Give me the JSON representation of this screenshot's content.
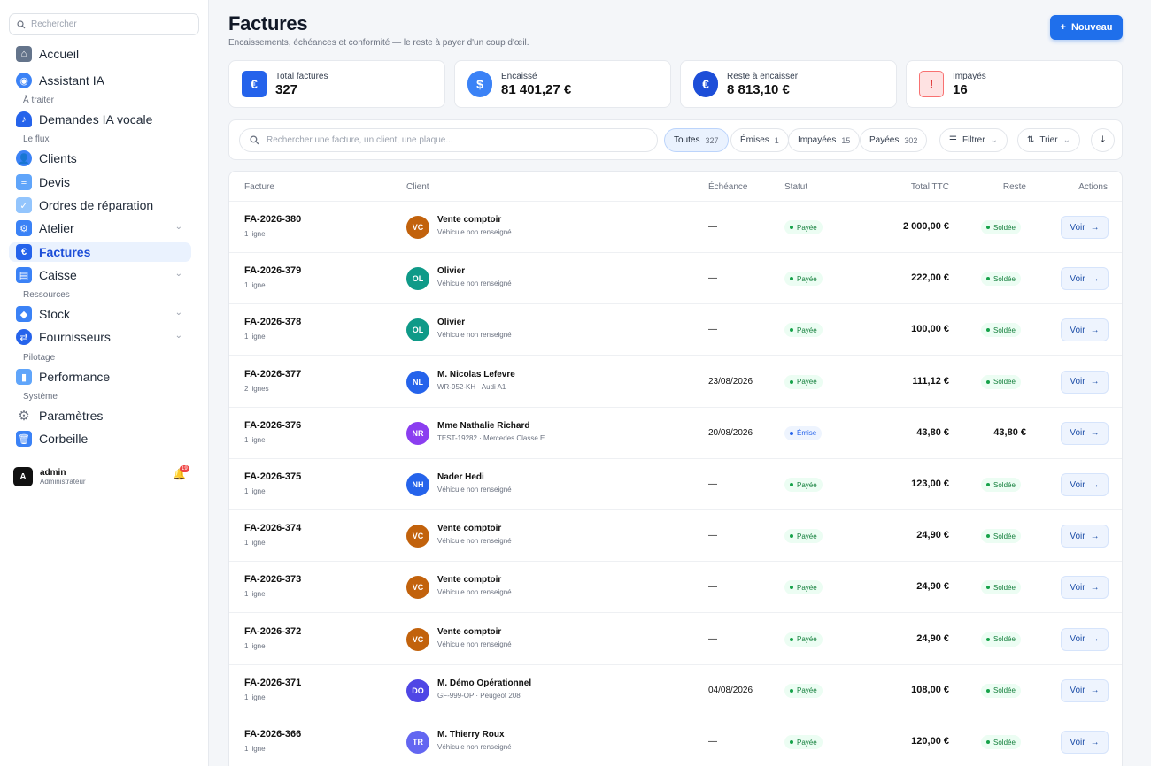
{
  "sidebar": {
    "search_placeholder": "Rechercher",
    "nav": [
      {
        "label": "Accueil",
        "icon": "home-icon"
      },
      {
        "label": "Assistant IA",
        "icon": "robot-icon"
      },
      {
        "label": "Demandes IA vocale",
        "icon": "bell-icon"
      },
      {
        "label": "Clients",
        "icon": "users-icon"
      },
      {
        "label": "Devis",
        "icon": "quote-icon"
      },
      {
        "label": "Ordres de réparation",
        "icon": "clipboard-icon"
      },
      {
        "label": "Atelier",
        "icon": "workshop-icon"
      },
      {
        "label": "Factures",
        "icon": "invoice-icon"
      },
      {
        "label": "Caisse",
        "icon": "cash-register-icon"
      },
      {
        "label": "Stock",
        "icon": "box-icon"
      },
      {
        "label": "Fournisseurs",
        "icon": "suppliers-icon"
      },
      {
        "label": "Performance",
        "icon": "chart-icon"
      },
      {
        "label": "Paramètres",
        "icon": "gear-icon"
      },
      {
        "label": "Corbeille",
        "icon": "trash-icon"
      }
    ],
    "sections": [
      "À traiter",
      "Le flux",
      "Ressources",
      "Pilotage",
      "Système"
    ],
    "user": {
      "initial": "A",
      "name": "admin",
      "role": "Administrateur",
      "notifications": "19"
    }
  },
  "header": {
    "title": "Factures",
    "subtitle": "Encaissements, échéances et conformité — le reste à payer d'un coup d'œil.",
    "new_button": "Nouveau"
  },
  "kpis": [
    {
      "label": "Total factures",
      "value": "327",
      "icon": "euro-card-icon"
    },
    {
      "label": "Encaissé",
      "value": "81 401,27 €",
      "icon": "coins-hand-icon"
    },
    {
      "label": "Reste à encaisser",
      "value": "8 813,10 €",
      "icon": "euro-coin-icon"
    },
    {
      "label": "Impayés",
      "value": "16",
      "icon": "unpaid-bill-icon"
    }
  ],
  "filters": {
    "search_placeholder": "Rechercher une facture, un client, une plaque...",
    "tabs": [
      {
        "label": "Toutes",
        "count": "327"
      },
      {
        "label": "Émises",
        "count": "1"
      },
      {
        "label": "Impayées",
        "count": "15"
      },
      {
        "label": "Payées",
        "count": "302"
      }
    ],
    "filter_label": "Filtrer",
    "sort_label": "Trier"
  },
  "table": {
    "columns": [
      "Facture",
      "Client",
      "Échéance",
      "Statut",
      "Total TTC",
      "Reste",
      "Actions"
    ],
    "view_label": "Voir",
    "rows": [
      {
        "invoice": "FA-2026-380",
        "lines": "1 ligne",
        "initials": "VC",
        "avatar_color": "#c2620c",
        "client": "Vente comptoir",
        "vehicle": "Véhicule non renseigné",
        "due": "—",
        "status": "Payée",
        "total": "2 000,00 €",
        "reste": "Soldée"
      },
      {
        "invoice": "FA-2026-379",
        "lines": "1 ligne",
        "initials": "OL",
        "avatar_color": "#0f9a88",
        "client": "Olivier",
        "vehicle": "Véhicule non renseigné",
        "due": "—",
        "status": "Payée",
        "total": "222,00 €",
        "reste": "Soldée"
      },
      {
        "invoice": "FA-2026-378",
        "lines": "1 ligne",
        "initials": "OL",
        "avatar_color": "#0f9a88",
        "client": "Olivier",
        "vehicle": "Véhicule non renseigné",
        "due": "—",
        "status": "Payée",
        "total": "100,00 €",
        "reste": "Soldée"
      },
      {
        "invoice": "FA-2026-377",
        "lines": "2 lignes",
        "initials": "NL",
        "avatar_color": "#2563eb",
        "client": "M. Nicolas Lefevre",
        "vehicle": "WR-952-KH · Audi A1",
        "due": "23/08/2026",
        "status": "Payée",
        "total": "111,12 €",
        "reste": "Soldée"
      },
      {
        "invoice": "FA-2026-376",
        "lines": "1 ligne",
        "initials": "NR",
        "avatar_color": "#8b3ef0",
        "client": "Mme Nathalie Richard",
        "vehicle": "TEST-19282 · Mercedes Classe E",
        "due": "20/08/2026",
        "status": "Émise",
        "total": "43,80 €",
        "reste": "43,80 €"
      },
      {
        "invoice": "FA-2026-375",
        "lines": "1 ligne",
        "initials": "NH",
        "avatar_color": "#2563eb",
        "client": "Nader Hedi",
        "vehicle": "Véhicule non renseigné",
        "due": "—",
        "status": "Payée",
        "total": "123,00 €",
        "reste": "Soldée"
      },
      {
        "invoice": "FA-2026-374",
        "lines": "1 ligne",
        "initials": "VC",
        "avatar_color": "#c2620c",
        "client": "Vente comptoir",
        "vehicle": "Véhicule non renseigné",
        "due": "—",
        "status": "Payée",
        "total": "24,90 €",
        "reste": "Soldée"
      },
      {
        "invoice": "FA-2026-373",
        "lines": "1 ligne",
        "initials": "VC",
        "avatar_color": "#c2620c",
        "client": "Vente comptoir",
        "vehicle": "Véhicule non renseigné",
        "due": "—",
        "status": "Payée",
        "total": "24,90 €",
        "reste": "Soldée"
      },
      {
        "invoice": "FA-2026-372",
        "lines": "1 ligne",
        "initials": "VC",
        "avatar_color": "#c2620c",
        "client": "Vente comptoir",
        "vehicle": "Véhicule non renseigné",
        "due": "—",
        "status": "Payée",
        "total": "24,90 €",
        "reste": "Soldée"
      },
      {
        "invoice": "FA-2026-371",
        "lines": "1 ligne",
        "initials": "DO",
        "avatar_color": "#4f46e5",
        "client": "M. Démo Opérationnel",
        "vehicle": "GF-999-OP · Peugeot 208",
        "due": "04/08/2026",
        "status": "Payée",
        "total": "108,00 €",
        "reste": "Soldée"
      },
      {
        "invoice": "FA-2026-366",
        "lines": "1 ligne",
        "initials": "TR",
        "avatar_color": "#6366f1",
        "client": "M. Thierry Roux",
        "vehicle": "Véhicule non renseigné",
        "due": "—",
        "status": "Payée",
        "total": "120,00 €",
        "reste": "Soldée"
      }
    ]
  }
}
